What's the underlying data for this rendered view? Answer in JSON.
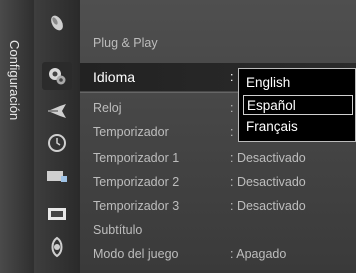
{
  "sidebar": {
    "title": "Configuración"
  },
  "icons": [
    {
      "name": "picture-icon"
    },
    {
      "name": "settings-icon"
    },
    {
      "name": "sound-icon"
    },
    {
      "name": "clock-icon"
    },
    {
      "name": "channel-icon"
    },
    {
      "name": "input-icon"
    },
    {
      "name": "support-icon"
    }
  ],
  "menu": {
    "items": [
      {
        "label": "Plug & Play",
        "value": ""
      },
      {
        "label": "Idioma",
        "value": ":"
      },
      {
        "label": "Reloj",
        "value": ":"
      },
      {
        "label": "Temporizador",
        "value": ":"
      },
      {
        "label": "Temporizador 1",
        "value": ": Desactivado"
      },
      {
        "label": "Temporizador 2",
        "value": ": Desactivado"
      },
      {
        "label": "Temporizador 3",
        "value": ": Desactivado"
      },
      {
        "label": "Subtítulo",
        "value": ""
      },
      {
        "label": "Modo del juego",
        "value": ": Apagado"
      }
    ]
  },
  "dropdown": {
    "options": [
      "English",
      "Español",
      "Français"
    ],
    "highlighted": "Español"
  }
}
